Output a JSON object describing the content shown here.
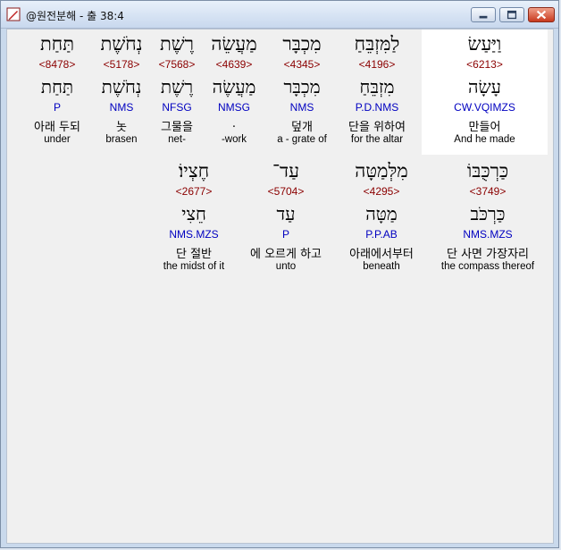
{
  "window": {
    "title": "@원전분해 - 출 38:4"
  },
  "row1": [
    {
      "heb": "תַּחַת",
      "strong": "<8478>",
      "lemma": "תַּחַת",
      "morph": "P",
      "kor": "아래 두되",
      "eng": "under",
      "highlighted": false
    },
    {
      "heb": "נְחֹשֶׁת",
      "strong": "<5178>",
      "lemma": "נְחֹשֶׁת",
      "morph": "NMS",
      "kor": "놋",
      "eng": "brasen",
      "highlighted": false
    },
    {
      "heb": "רֶשֶׁת",
      "strong": "<7568>",
      "lemma": "רֶשֶׁת",
      "morph": "NFSG",
      "kor": "그물을",
      "eng": "net-",
      "highlighted": false
    },
    {
      "heb": "מַעֲשֵׂה",
      "strong": "<4639>",
      "lemma": "מַעֲשֶׂה",
      "morph": "NMSG",
      "kor": ".",
      "eng": "-work",
      "highlighted": false
    },
    {
      "heb": "מִכְבָּר",
      "strong": "<4345>",
      "lemma": "מִכְבָּר",
      "morph": "NMS",
      "kor": "덮개",
      "eng": "a - grate of",
      "highlighted": false
    },
    {
      "heb": "לַמִּזְבֵּחַ",
      "strong": "<4196>",
      "lemma": "מִזְבֵּחַ",
      "morph": "P.D.NMS",
      "kor": "단을 위하여",
      "eng": "for the altar",
      "highlighted": false
    },
    {
      "heb": "וַיַּעַשׂ",
      "strong": "<6213>",
      "lemma": "עָשָׂה",
      "morph": "CW.VQIMZS",
      "kor": "만들어",
      "eng": "And he made",
      "highlighted": true
    }
  ],
  "row2": [
    {
      "heb": "חֶצְיוֹ׃",
      "strong": "<2677>",
      "lemma": "חֵצִי",
      "morph": "NMS.MZS",
      "kor": "단 절반",
      "eng": "the midst of it"
    },
    {
      "heb": "עַד־",
      "strong": "<5704>",
      "lemma": "עַד",
      "morph": "P",
      "kor": "에 오르게 하고",
      "eng": "unto"
    },
    {
      "heb": "מִלְּמַטָּה",
      "strong": "<4295>",
      "lemma": "מַטָּה",
      "morph": "P.P.AB",
      "kor": "아래에서부터",
      "eng": "beneath"
    },
    {
      "heb": "כַּרְכֻּבּוֹ",
      "strong": "<3749>",
      "lemma": "כַּרְכֹּב",
      "morph": "NMS.MZS",
      "kor": "단 사면 가장자리",
      "eng": "the compass thereof"
    }
  ]
}
